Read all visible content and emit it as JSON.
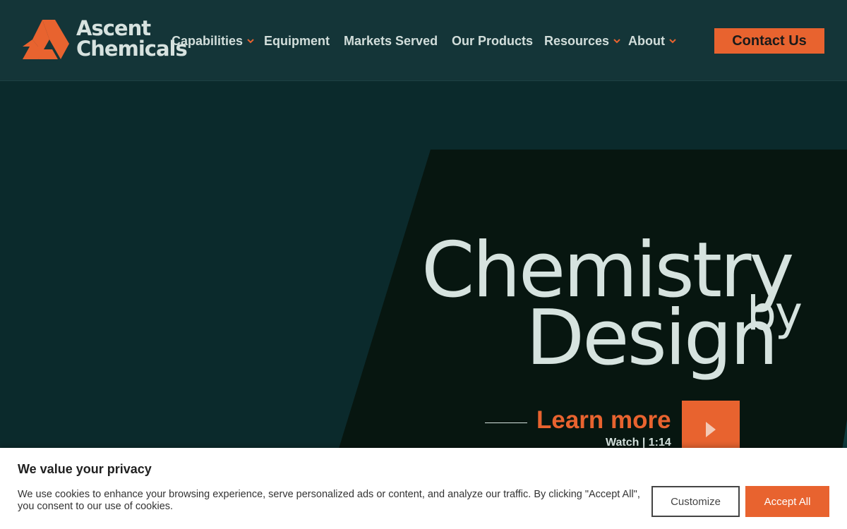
{
  "brand": {
    "name_line1": "Ascent",
    "name_line2": "Chemicals",
    "accent_color": "#e8632f",
    "bg_color": "#0b2a2c"
  },
  "nav": {
    "items": [
      {
        "label": "Capabilities",
        "has_dropdown": true
      },
      {
        "label": "Equipment",
        "has_dropdown": false
      },
      {
        "label": "Markets Served",
        "has_dropdown": false
      },
      {
        "label": "Our Products",
        "has_dropdown": false
      },
      {
        "label": "Resources",
        "has_dropdown": true
      },
      {
        "label": "About",
        "has_dropdown": true
      }
    ],
    "contact_label": "Contact Us"
  },
  "hero": {
    "headline_word1": "Chemistry",
    "headline_word2": "by",
    "headline_word3": "Design",
    "cta_label": "Learn more",
    "video_label": "Watch | 1:14",
    "play_icon": "play-icon"
  },
  "cookie": {
    "title": "We value your privacy",
    "text": "We use cookies to enhance your browsing experience, serve personalized ads or content, and analyze our traffic. By clicking \"Accept All\", you consent to our use of cookies.",
    "customize_label": "Customize",
    "accept_label": "Accept All"
  }
}
